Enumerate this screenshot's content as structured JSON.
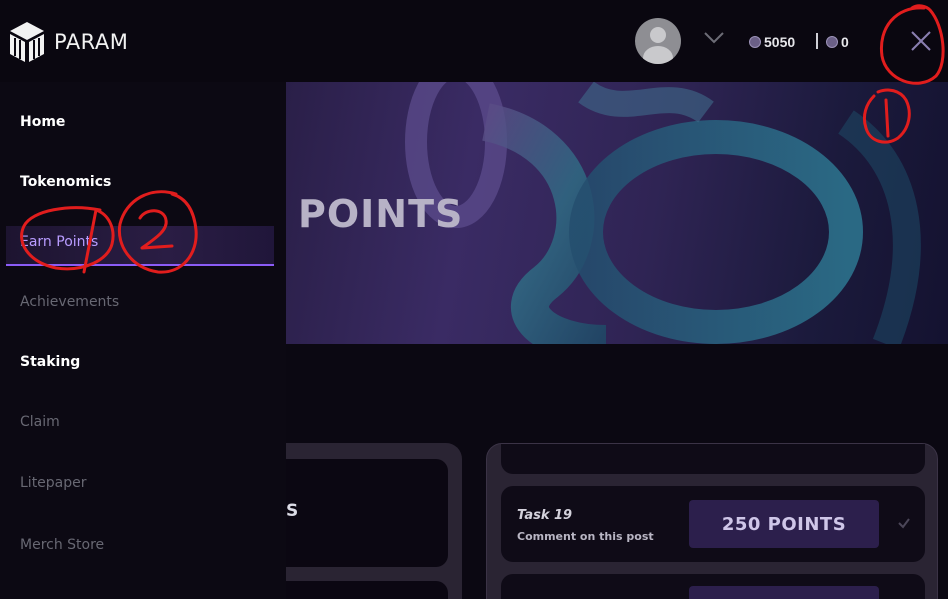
{
  "brand": {
    "name": "PARAM"
  },
  "header": {
    "points_balance": "5050",
    "token_balance": "0",
    "icons": {
      "avatar": "user-avatar",
      "menu": "chevron-down-icon",
      "close": "close-icon"
    }
  },
  "sidebar": {
    "items": [
      {
        "label": "Home",
        "state": "active"
      },
      {
        "label": "Tokenomics",
        "state": "active"
      },
      {
        "label": "Earn Points",
        "state": "current"
      },
      {
        "label": "Achievements",
        "state": "dim"
      },
      {
        "label": "Staking",
        "state": "active"
      },
      {
        "label": "Claim",
        "state": "dim"
      },
      {
        "label": "Litepaper",
        "state": "dim"
      },
      {
        "label": "Merch Store",
        "state": "dim"
      }
    ]
  },
  "hero": {
    "title": "POINTS"
  },
  "content": {
    "left_panel_peek": "S",
    "task": {
      "name": "Task 19",
      "description": "Comment on this post",
      "reward_label": "250 POINTS"
    }
  },
  "annotations": {
    "mark_1": "1",
    "mark_2": "2"
  },
  "colors": {
    "accent": "#8b5cf6",
    "annotation": "#e11d1d",
    "background": "#0b0812"
  }
}
